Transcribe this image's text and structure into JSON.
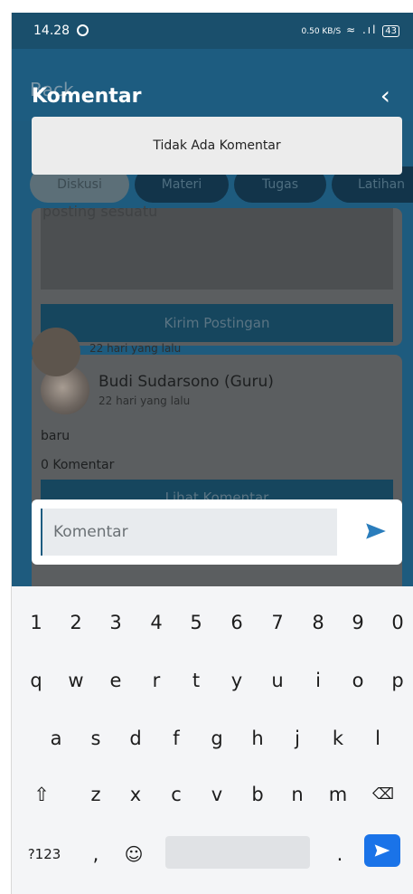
{
  "status": {
    "time": "14.28",
    "net": "0.50 KB/S",
    "battery": "43"
  },
  "appbar": {
    "title": "Komentar",
    "ghost_back": "Back"
  },
  "tabs": [
    "Diskusi",
    "Materi",
    "Tugas",
    "Latihan"
  ],
  "post": {
    "hint": "posting sesuatu",
    "button": "Kirim Postingan"
  },
  "feed": {
    "author": "Budi Sudarsono (Guru)",
    "time": "22 hari yang lalu",
    "content": "baru",
    "comment_count": "0 Komentar",
    "button": "Lihat Komentar",
    "next_time": "22 hari yang lalu"
  },
  "dialog": {
    "message": "Tidak Ada Komentar"
  },
  "comment": {
    "placeholder": "Komentar"
  },
  "keyboard": {
    "row_numbers": [
      "1",
      "2",
      "3",
      "4",
      "5",
      "6",
      "7",
      "8",
      "9",
      "0"
    ],
    "row_top": [
      "q",
      "w",
      "e",
      "r",
      "t",
      "y",
      "u",
      "i",
      "o",
      "p"
    ],
    "row_middle": [
      "a",
      "s",
      "d",
      "f",
      "g",
      "h",
      "j",
      "k",
      "l"
    ],
    "row_bottom": [
      "z",
      "x",
      "c",
      "v",
      "b",
      "n",
      "m"
    ],
    "symbols": "?123",
    "comma": ",",
    "period": "."
  },
  "colors": {
    "primary": "#1d5c80",
    "enter_key": "#1a73e8"
  }
}
